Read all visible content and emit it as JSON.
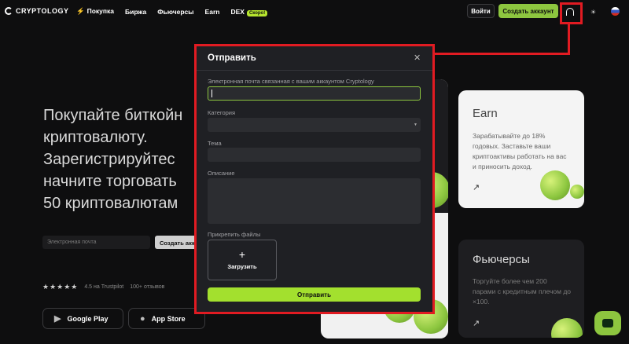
{
  "header": {
    "logo_text": "CRYPTOLOGY",
    "nav": [
      {
        "label": "Покупка",
        "bolt": "⚡"
      },
      {
        "label": "Биржа"
      },
      {
        "label": "Фьючерсы"
      },
      {
        "label": "Earn"
      },
      {
        "label": "DEX",
        "badge": "Скоро!"
      }
    ],
    "login_label": "Войти",
    "signup_label": "Создать аккаунт",
    "support_icon": "headset-icon",
    "theme_icon": "sun-icon",
    "language_icon": "russia-flag-icon",
    "accent_color": "#8dc63f"
  },
  "hero": {
    "title_lines": [
      "Покупайте биткойн",
      "криптовалюту.",
      "Зарегистрируйтес",
      "начните торговать",
      "50 криптовалютам"
    ],
    "email_placeholder": "Электронная почта",
    "submit_label": "Создать акк",
    "stars": "★★★★★",
    "rating": "4.5 на Trustpilot",
    "reviews": "100+ отзывов",
    "google_play": "Google Play",
    "app_store": "App Store"
  },
  "cards": {
    "earn_title": "Earn",
    "earn_desc": "Зарабатывайте до 18% годовых. Заставьте ваши криптоактивы работать на вас и приносить доход.",
    "futures_title": "Фьючерсы",
    "futures_desc": "Торгуйте более чем 200 парами с кредитным плечом до ×100.",
    "arrow": "↗"
  },
  "modal": {
    "title": "Отправить",
    "close": "✕",
    "email_label": "Электронная почта связанная с вашим аккаунтом Cryptology",
    "email_value": "",
    "category_label": "Категория",
    "category_value": "",
    "subject_label": "Тема",
    "description_label": "Описание",
    "attach_label": "Прикрепить файлы",
    "upload_plus": "+",
    "upload_label": "Загрузить",
    "send_label": "Отправить",
    "highlight_color": "#e11b22"
  }
}
